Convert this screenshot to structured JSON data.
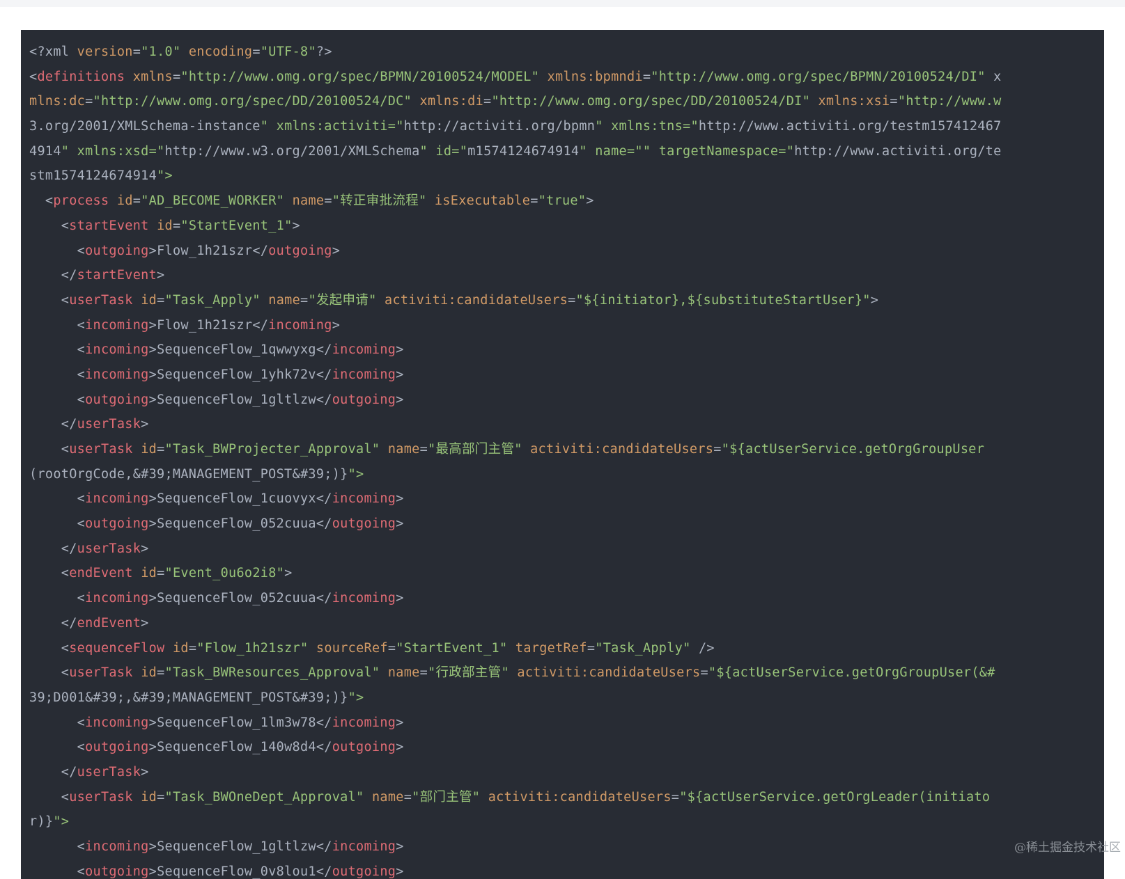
{
  "code_lines": [
    "<?xml version=\"1.0\" encoding=\"UTF-8\"?>",
    "<definitions xmlns=\"http://www.omg.org/spec/BPMN/20100524/MODEL\" xmlns:bpmndi=\"http://www.omg.org/spec/BPMN/20100524/DI\" x",
    "mlns:dc=\"http://www.omg.org/spec/DD/20100524/DC\" xmlns:di=\"http://www.omg.org/spec/DD/20100524/DI\" xmlns:xsi=\"http://www.w",
    "3.org/2001/XMLSchema-instance\" xmlns:activiti=\"http://activiti.org/bpmn\" xmlns:tns=\"http://www.activiti.org/testm157412467",
    "4914\" xmlns:xsd=\"http://www.w3.org/2001/XMLSchema\" id=\"m1574124674914\" name=\"\" targetNamespace=\"http://www.activiti.org/te",
    "stm1574124674914\">",
    "  <process id=\"AD_BECOME_WORKER\" name=\"转正审批流程\" isExecutable=\"true\">",
    "    <startEvent id=\"StartEvent_1\">",
    "      <outgoing>Flow_1h21szr</outgoing>",
    "    </startEvent>",
    "    <userTask id=\"Task_Apply\" name=\"发起申请\" activiti:candidateUsers=\"${initiator},${substituteStartUser}\">",
    "      <incoming>Flow_1h21szr</incoming>",
    "      <incoming>SequenceFlow_1qwwyxg</incoming>",
    "      <incoming>SequenceFlow_1yhk72v</incoming>",
    "      <outgoing>SequenceFlow_1gltlzw</outgoing>",
    "    </userTask>",
    "    <userTask id=\"Task_BWProjecter_Approval\" name=\"最高部门主管\" activiti:candidateUsers=\"${actUserService.getOrgGroupUser",
    "(rootOrgCode,&#39;MANAGEMENT_POST&#39;)}\">",
    "      <incoming>SequenceFlow_1cuovyx</incoming>",
    "      <outgoing>SequenceFlow_052cuua</outgoing>",
    "    </userTask>",
    "    <endEvent id=\"Event_0u6o2i8\">",
    "      <incoming>SequenceFlow_052cuua</incoming>",
    "    </endEvent>",
    "    <sequenceFlow id=\"Flow_1h21szr\" sourceRef=\"StartEvent_1\" targetRef=\"Task_Apply\" />",
    "    <userTask id=\"Task_BWResources_Approval\" name=\"行政部主管\" activiti:candidateUsers=\"${actUserService.getOrgGroupUser(&#",
    "39;D001&#39;,&#39;MANAGEMENT_POST&#39;)}\">",
    "      <incoming>SequenceFlow_1lm3w78</incoming>",
    "      <outgoing>SequenceFlow_140w8d4</outgoing>",
    "    </userTask>",
    "    <userTask id=\"Task_BWOneDept_Approval\" name=\"部门主管\" activiti:candidateUsers=\"${actUserService.getOrgLeader(initiato",
    "r)}\">",
    "      <incoming>SequenceFlow_1gltlzw</incoming>",
    "      <outgoing>SequenceFlow_0v8lou1</outgoing>"
  ],
  "watermark": "@稀土掘金技术社区",
  "colors": {
    "background": "#282c34",
    "tag": "#e06c75",
    "attribute": "#d19a66",
    "string": "#98c379",
    "text": "#abb2bf"
  }
}
